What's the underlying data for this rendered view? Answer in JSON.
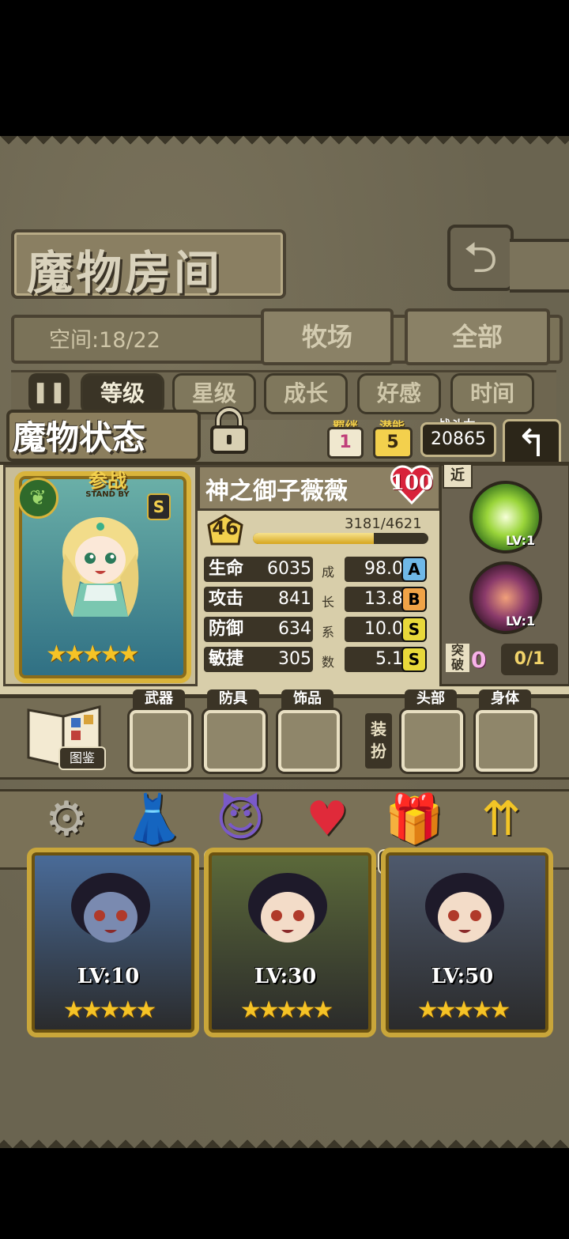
{
  "header": {
    "title": "魔物房间",
    "back_icon": "return-arrow-icon"
  },
  "tabs": {
    "space_label": "空间:18/22",
    "ranch": "牧场",
    "all": "全部"
  },
  "sort": {
    "buttons": [
      "等级",
      "星级",
      "成长",
      "好感",
      "时间"
    ],
    "active_index": 0
  },
  "status": {
    "title": "魔物状态",
    "bond_label": "羁绊",
    "bond_value": "1",
    "potential_label": "潜能",
    "potential_value": "5",
    "power_label": "战斗力",
    "power_value": "20865"
  },
  "monster": {
    "name": "神之御子薇薇",
    "affection": "100",
    "standby_main": "参战",
    "standby_sub": "STAND BY",
    "rank_badge": "S",
    "stars": 5,
    "level": "46",
    "exp_text": "3181/4621",
    "exp_fraction": 0.688,
    "stats": [
      {
        "name": "生命",
        "value": "6035",
        "growth": "98.0",
        "grade": "A",
        "grade_color": "#6fb8e8"
      },
      {
        "name": "攻击",
        "value": "841",
        "growth": "13.8",
        "grade": "B",
        "grade_color": "#f0a347"
      },
      {
        "name": "防御",
        "value": "634",
        "growth": "10.0",
        "grade": "S",
        "grade_color": "#e8d83a"
      },
      {
        "name": "敏捷",
        "value": "305",
        "growth": "5.1",
        "grade": "S",
        "grade_color": "#e8d83a"
      }
    ],
    "coef_chars": [
      "成",
      "长",
      "系",
      "数"
    ]
  },
  "skills": {
    "range_label": "近",
    "items": [
      {
        "lv": "LV:1"
      },
      {
        "lv": "LV:1"
      }
    ],
    "break_label": "突破",
    "break_value": "0",
    "break_fraction": "0/1"
  },
  "equip": {
    "book_label": "图鉴",
    "slots": [
      "武器",
      "防具",
      "饰品",
      "头部",
      "身体"
    ],
    "dress_label": "装扮"
  },
  "actions": [
    {
      "label": "操作",
      "icon": "gear-icon"
    },
    {
      "label": "时装",
      "icon": "outfit-icon"
    },
    {
      "label": "潜能",
      "icon": "demon-icon"
    },
    {
      "label": "羁绊",
      "icon": "hearts-icon"
    },
    {
      "label": "送礼",
      "icon": "gift-icon"
    },
    {
      "label": "强化",
      "icon": "upgrade-arrows-icon"
    }
  ],
  "monsters": [
    {
      "lv": "LV:10",
      "stars": 5,
      "bg": "#4a6c9a"
    },
    {
      "lv": "LV:30",
      "stars": 5,
      "bg": "#5c6a3a"
    },
    {
      "lv": "LV:50",
      "stars": 5,
      "bg": "#4f5a6e"
    }
  ]
}
